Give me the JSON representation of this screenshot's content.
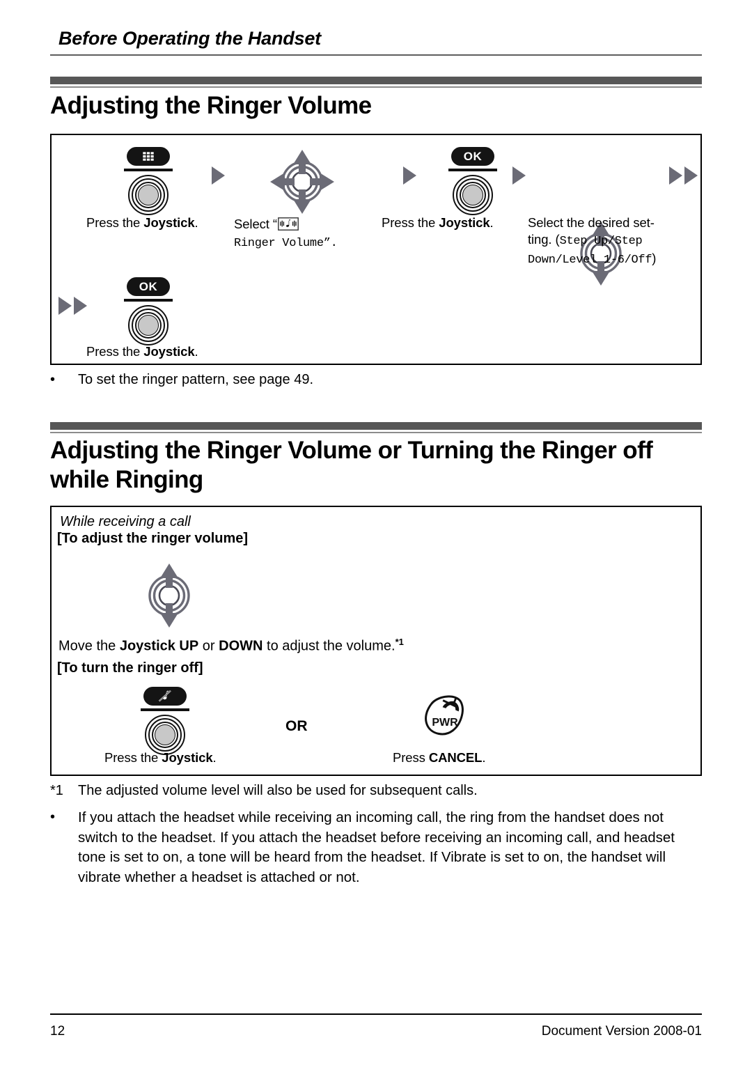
{
  "running_head": "Before Operating the Handset",
  "sections": [
    {
      "title": "Adjusting the Ringer Volume",
      "steps": [
        {
          "icon": "menu-softkey-joystick",
          "caption_parts": [
            {
              "t": "Press the ",
              "b": false
            },
            {
              "t": "Joystick",
              "b": true
            },
            {
              "t": ".",
              "b": false
            }
          ]
        },
        {
          "icon": "four-way-joystick-arrows",
          "caption_line1": "Select “",
          "caption_icon": "ringer-volume-glyph",
          "caption_line2": "Ringer Volume”."
        },
        {
          "icon": "ok-softkey-joystick",
          "caption_parts": [
            {
              "t": "Press the ",
              "b": false
            },
            {
              "t": "Joystick",
              "b": true
            },
            {
              "t": ".",
              "b": false
            }
          ]
        },
        {
          "icon": "up-down-joystick-arrows",
          "caption_line1": "Select the desired set-",
          "caption_line2a": "ting. (",
          "caption_mono2": "Step Up/Step",
          "caption_mono3": "Down/Level 1-6/Off",
          "caption_close": ")"
        },
        {
          "icon": "ok-softkey-joystick",
          "caption_parts": [
            {
              "t": "Press the ",
              "b": false
            },
            {
              "t": "Joystick",
              "b": true
            },
            {
              "t": ".",
              "b": false
            }
          ]
        }
      ],
      "badges": {
        "ok": "OK"
      },
      "note_bullet": "To set the ringer pattern, see page 49."
    },
    {
      "title_line1": "Adjusting the Ringer Volume or Turning the Ringer off",
      "title_line2": "while Ringing",
      "subheading_italic": "While receiving a call",
      "subheading_bold_1": "[To adjust the ringer volume]",
      "instruction_1": [
        {
          "t": "Move the ",
          "b": false
        },
        {
          "t": "Joystick UP",
          "b": true
        },
        {
          "t": " or ",
          "b": false
        },
        {
          "t": "DOWN",
          "b": true
        },
        {
          "t": " to adjust the volume.",
          "b": false
        }
      ],
      "instruction_1_sup": "*1",
      "subheading_bold_2": "[To turn the ringer off]",
      "or_label": "OR",
      "caption_left": [
        {
          "t": "Press the ",
          "b": false
        },
        {
          "t": "Joystick",
          "b": true
        },
        {
          "t": ".",
          "b": false
        }
      ],
      "caption_right": [
        {
          "t": "Press ",
          "b": false
        },
        {
          "t": "CANCEL",
          "b": true
        },
        {
          "t": ".",
          "b": false
        }
      ],
      "pwr_label": "PWR",
      "footnote_marker": "*1",
      "footnote_text": "The adjusted volume level will also be used for subsequent calls.",
      "bullet_marker": "•",
      "bullet_text": "If you attach the headset while receiving an incoming call, the ring from the handset does not switch to the headset. If you attach the headset before receiving an incoming call, and headset tone is set to on, a tone will be heard from the headset. If Vibrate is set to on, the handset will vibrate whether a headset is attached or not."
    }
  ],
  "bullet_marker": "•",
  "footer": {
    "page_number": "12",
    "document_version": "Document Version 2008-01"
  },
  "colors": {
    "rule_gray": "#5e5e5e",
    "bar_gray": "#575757",
    "arrow_gray": "#6b6b76",
    "badge_black": "#141414",
    "hub_gray": "#c8c8c8"
  }
}
